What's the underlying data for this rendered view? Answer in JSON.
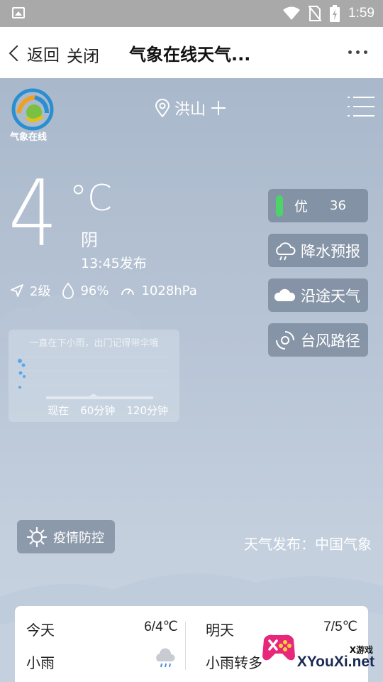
{
  "statusbar": {
    "time": "1:59"
  },
  "nav": {
    "back_label": "返回",
    "close_label": "关闭",
    "title": "气象在线天气..."
  },
  "logo_text": "气象在线",
  "location": {
    "name": "洪山"
  },
  "current": {
    "temperature": "4",
    "unit": "°C",
    "condition": "阴",
    "publish_time": "13:45发布",
    "wind": "2级",
    "humidity": "96%",
    "pressure": "1028hPa"
  },
  "rain_card": {
    "message": "一直在下小雨，出门记得带伞哦",
    "axis": [
      "现在",
      "60分钟",
      "120分钟"
    ]
  },
  "right_buttons": {
    "aqi_label": "优",
    "aqi_value": "36",
    "precip": "降水预报",
    "route": "沿途天气",
    "typhoon": "台风路径"
  },
  "epidemic_label": "疫情防控",
  "source": "天气发布：中国气象",
  "forecast": [
    {
      "day": "今天",
      "range": "6/4℃",
      "condition": "小雨"
    },
    {
      "day": "明天",
      "range": "7/5℃",
      "condition": "小雨转多"
    }
  ],
  "watermark": {
    "top": "X游戏",
    "main": "XYouXi.net"
  },
  "colors": {
    "aqi_good": "#4cd46a",
    "sky_top": "#a9b8cb",
    "sky_bottom": "#c9d4e1"
  }
}
